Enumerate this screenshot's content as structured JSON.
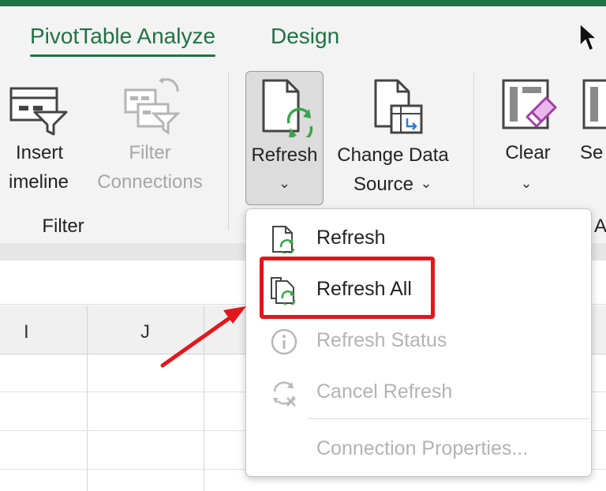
{
  "tabs": [
    {
      "label": "PivotTable Analyze",
      "active": true
    },
    {
      "label": "Design",
      "active": false
    }
  ],
  "ribbon": {
    "insert_timeline": {
      "line1": "Insert",
      "line2": "imeline"
    },
    "filter_connections": {
      "line1": "Filter",
      "line2": "Connections"
    },
    "filter_group_label": "Filter",
    "refresh": {
      "label": "Refresh",
      "chevron": "⌄"
    },
    "change_data_source": {
      "line1": "Change Data",
      "line2": "Source",
      "chevron": "⌄"
    },
    "clear": {
      "label": "Clear",
      "chevron": "⌄"
    },
    "select_partial": "Se",
    "actions_partial": "A"
  },
  "grid": {
    "columns": [
      "I",
      "J"
    ]
  },
  "menu": {
    "items": [
      {
        "label": "Refresh",
        "enabled": true,
        "icon": "refresh-icon"
      },
      {
        "label": "Refresh All",
        "enabled": true,
        "icon": "refresh-all-icon"
      },
      {
        "label": "Refresh Status",
        "enabled": false,
        "icon": "info-icon"
      },
      {
        "label": "Cancel Refresh",
        "enabled": false,
        "icon": "cancel-refresh-icon"
      },
      {
        "label": "Connection Properties...",
        "enabled": false,
        "icon": ""
      }
    ]
  },
  "colors": {
    "accent": "#1f7244",
    "highlight": "#e3161b",
    "refresh_green": "#3aa54a"
  }
}
